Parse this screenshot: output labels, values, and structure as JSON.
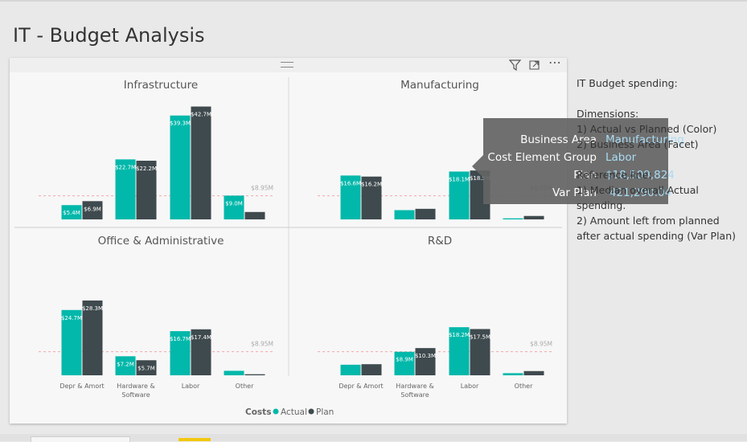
{
  "page": {
    "title": "IT - Budget Analysis"
  },
  "visual_header": {
    "icons": [
      "filter-icon",
      "focus-mode-icon",
      "more-options-icon"
    ],
    "more_glyph": "⋯"
  },
  "tooltip": {
    "rows": [
      {
        "key": "Business Area",
        "value": "Manufacturing"
      },
      {
        "key": "Cost Element Group",
        "value": "Labor"
      },
      {
        "key": "Plan",
        "value": "$18,509,824"
      },
      {
        "key": "Var Plan",
        "value": "-421,290.04"
      }
    ]
  },
  "text_box": {
    "lines": [
      "IT Budget spending:",
      "",
      "Dimensions:",
      "1) Actual vs Planned (Color)",
      "2) Business Area (Facet)",
      "",
      "Reference line:",
      "1) Median overall Actual spending.",
      "2) Amount left from planned after actual spending (Var Plan)"
    ]
  },
  "colors": {
    "actual": "#01b8aa",
    "plan": "#3f4a4e",
    "ref_line": "#f4a7a7"
  },
  "chart_data": {
    "type": "bar",
    "categories": [
      "Depr & Amort",
      "Hardware & Software",
      "Labor",
      "Other"
    ],
    "category_labels": [
      [
        "Depr & Amort"
      ],
      [
        "Hardware &",
        "Software"
      ],
      [
        "Labor"
      ],
      [
        "Other"
      ]
    ],
    "ylim": [
      0,
      45
    ],
    "reference_line": {
      "value": 8.95,
      "label": "$8.95M"
    },
    "legend": {
      "title": "Costs",
      "position": "bottom-center",
      "items": [
        {
          "name": "Actual",
          "color": "#01b8aa"
        },
        {
          "name": "Plan",
          "color": "#3f4a4e"
        }
      ]
    },
    "facets": [
      {
        "title": "Infrastructure",
        "series": [
          {
            "name": "Actual",
            "values": [
              5.4,
              22.7,
              39.3,
              9.0
            ],
            "labels": [
              "$5.4M",
              "$22.7M",
              "$39.3M",
              "$9.0M"
            ]
          },
          {
            "name": "Plan",
            "values": [
              6.9,
              22.2,
              42.7,
              2.8
            ],
            "labels": [
              "$6.9M",
              "$22.2M",
              "$42.7M",
              ""
            ]
          }
        ]
      },
      {
        "title": "Manufacturing",
        "series": [
          {
            "name": "Actual",
            "values": [
              16.6,
              3.5,
              18.1,
              0.4
            ],
            "labels": [
              "$16.6M",
              "",
              "$18.1M",
              ""
            ]
          },
          {
            "name": "Plan",
            "values": [
              16.2,
              4.0,
              18.5,
              1.3
            ],
            "labels": [
              "$16.2M",
              "",
              "$18.5M",
              ""
            ]
          }
        ]
      },
      {
        "title": "Office & Administrative",
        "series": [
          {
            "name": "Actual",
            "values": [
              24.7,
              7.2,
              16.7,
              1.7
            ],
            "labels": [
              "$24.7M",
              "$7.2M",
              "$16.7M",
              ""
            ]
          },
          {
            "name": "Plan",
            "values": [
              28.3,
              5.7,
              17.4,
              0.4
            ],
            "labels": [
              "$28.3M",
              "$5.7M",
              "$17.4M",
              ""
            ]
          }
        ]
      },
      {
        "title": "R&D",
        "series": [
          {
            "name": "Actual",
            "values": [
              4.0,
              8.9,
              18.2,
              0.8
            ],
            "labels": [
              "",
              "$8.9M",
              "$18.2M",
              ""
            ]
          },
          {
            "name": "Plan",
            "values": [
              4.2,
              10.3,
              17.5,
              1.6
            ],
            "labels": [
              "",
              "$10.3M",
              "$17.5M",
              ""
            ]
          }
        ]
      }
    ]
  }
}
